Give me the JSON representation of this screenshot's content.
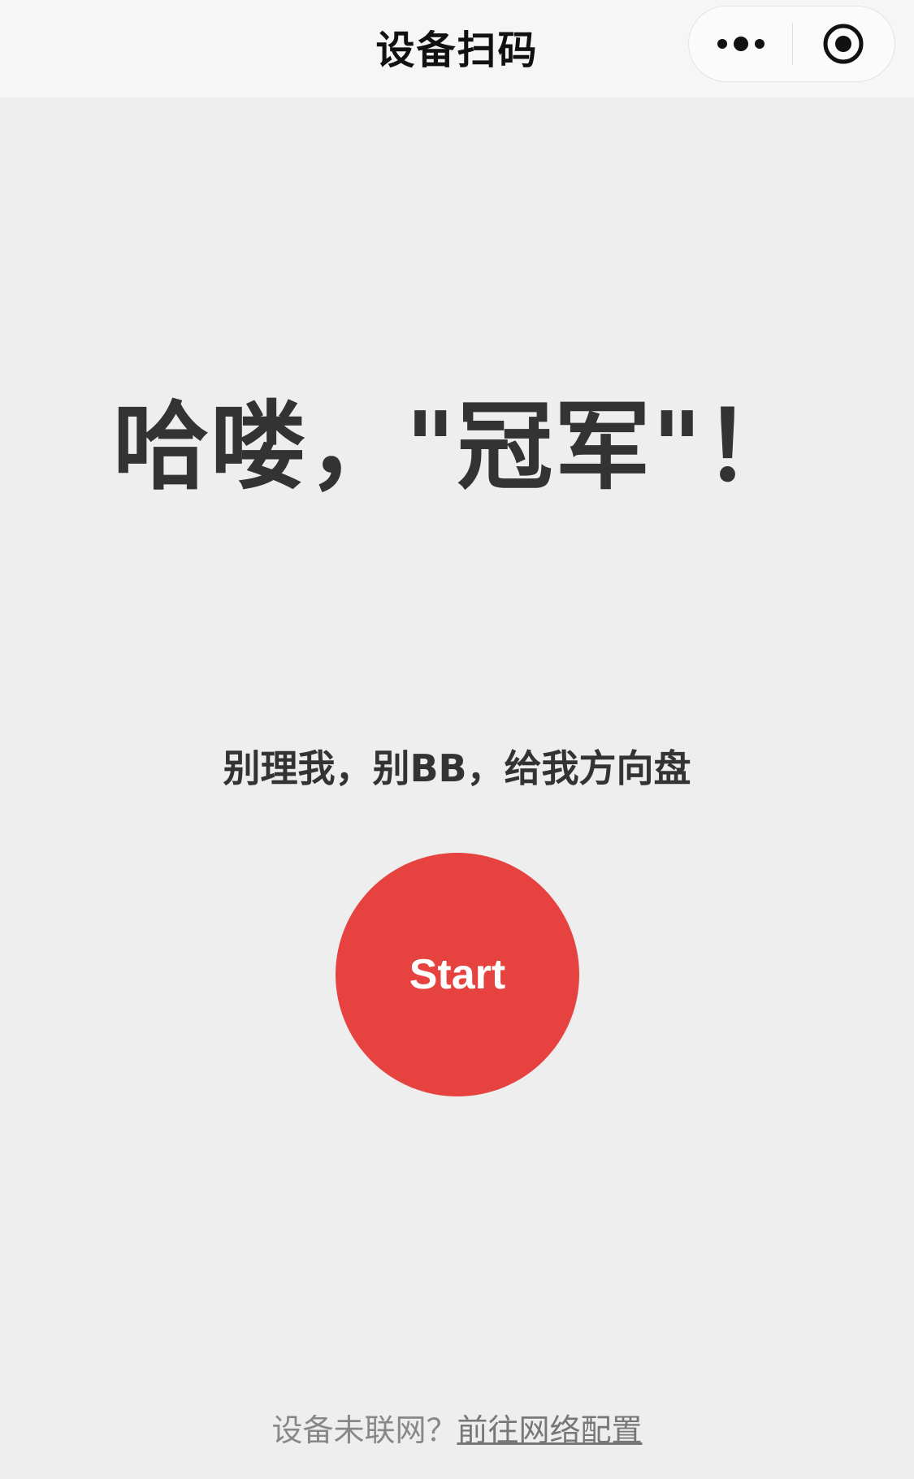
{
  "nav": {
    "title": "设备扫码",
    "more_icon": "more-dots-icon",
    "close_icon": "target-close-icon"
  },
  "main": {
    "hero_title": "哈喽，\"冠军\"！",
    "tagline": "别理我，别BB，给我方向盘",
    "start_label": "Start",
    "start_color": "#e64340"
  },
  "footer": {
    "prompt": "设备未联网？",
    "link": "前往网络配置"
  }
}
